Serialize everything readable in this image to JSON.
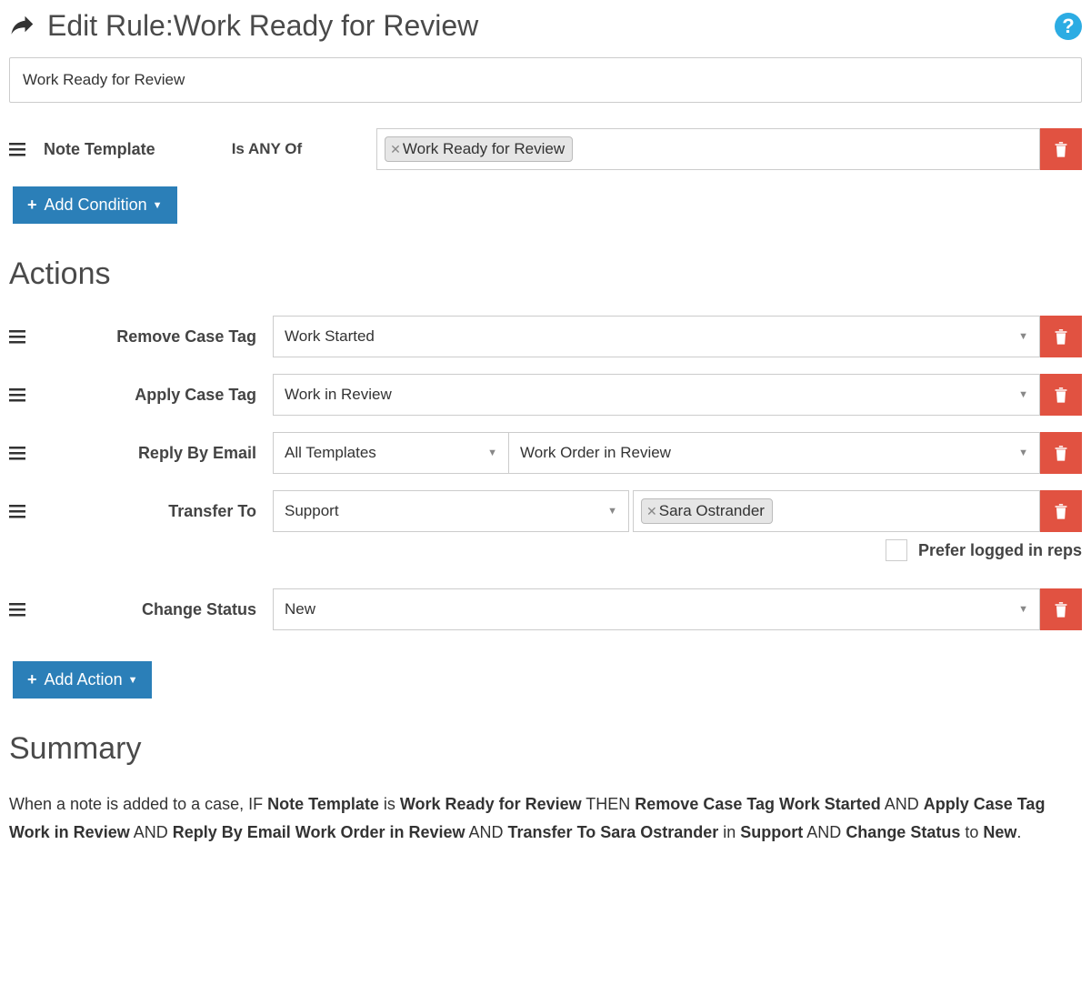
{
  "header": {
    "title_prefix": "Edit Rule: ",
    "title_name": "Work Ready for Review"
  },
  "rule_name_value": "Work Ready for Review",
  "condition": {
    "field_label": "Note Template",
    "operator_label": "Is ANY Of",
    "tags": [
      "Work Ready for Review"
    ]
  },
  "add_condition_label": "Add Condition",
  "actions_heading": "Actions",
  "actions": [
    {
      "label": "Remove Case Tag",
      "type": "select",
      "value": "Work Started"
    },
    {
      "label": "Apply Case Tag",
      "type": "select",
      "value": "Work in Review"
    },
    {
      "label": "Reply By Email",
      "type": "select2",
      "value1": "All Templates",
      "value2": "Work Order in Review"
    },
    {
      "label": "Transfer To",
      "type": "transfer",
      "department": "Support",
      "person_tag": "Sara Ostrander",
      "prefer_label": "Prefer logged in reps"
    },
    {
      "label": "Change Status",
      "type": "select",
      "value": "New"
    }
  ],
  "add_action_label": "Add Action",
  "summary_heading": "Summary",
  "summary": {
    "s0": "When a note is added to a case, IF ",
    "s1": "Note Template",
    "s2": " is ",
    "s3": "Work Ready for Review",
    "s4": " THEN ",
    "s5": "Remove Case Tag Work Started",
    "s6": " AND ",
    "s7": "Apply Case Tag Work in Review",
    "s8": " AND ",
    "s9": "Reply By Email Work Order in Review",
    "s10": " AND ",
    "s11": "Transfer To Sara Ostrander",
    "s12": " in ",
    "s13": "Support",
    "s14": " AND ",
    "s15": "Change Status",
    "s16": " to ",
    "s17": "New",
    "s18": "."
  }
}
